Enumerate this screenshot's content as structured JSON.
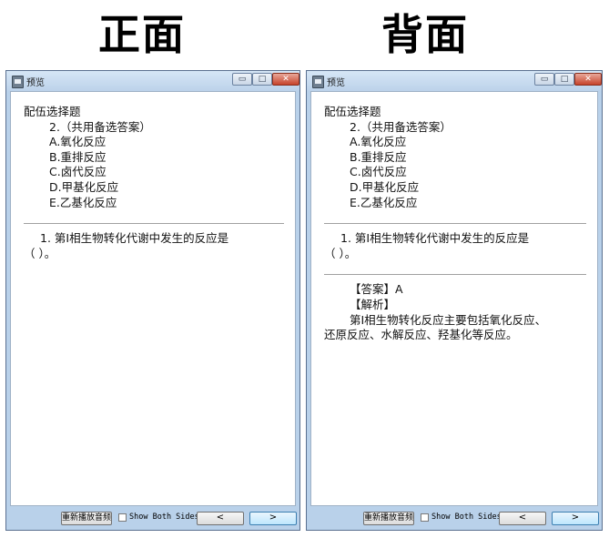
{
  "labels": {
    "front": "正面",
    "back": "背面"
  },
  "window": {
    "title": "预览",
    "controls": {
      "minimize": "▭",
      "maximize": "□",
      "close": "✕"
    }
  },
  "card": {
    "section_title": "配伍选择题",
    "group_stem": "2.（共用备选答案）",
    "options": [
      "A.氧化反应",
      "B.重排反应",
      "C.卤代反应",
      "D.甲基化反应",
      "E.乙基化反应"
    ],
    "question_line1": "1.  第Ⅰ相生物转化代谢中发生的反应是",
    "question_line2": "（      ）。",
    "answer": "【答案】A",
    "explanation_label": "【解析】",
    "explanation_line1": "第Ⅰ相生物转化反应主要包括氧化反应、",
    "explanation_line2": "还原反应、水解反应、羟基化等反应。"
  },
  "footer": {
    "replay_label": "重新播放音频",
    "show_both_sides_label": "Show Both Sides",
    "show_both_sides_checked": false,
    "prev_label": "<",
    "next_label": ">"
  }
}
